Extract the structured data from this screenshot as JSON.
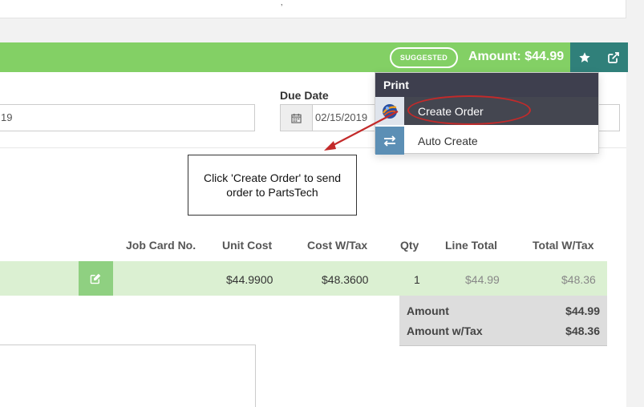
{
  "header": {
    "suggested_badge": "SUGGESTED",
    "amount": "Amount: $44.99"
  },
  "form": {
    "left_date_value": "19",
    "due_date_label": "Due Date",
    "due_date_value": "02/15/2019"
  },
  "print_menu": {
    "title": "Print",
    "items": [
      {
        "label": "Create Order",
        "icon": "partstech-logo-icon"
      },
      {
        "label": "Auto Create",
        "icon": "swap-arrows-icon"
      }
    ]
  },
  "callout": {
    "text": "Click 'Create Order' to send order to PartsTech"
  },
  "table": {
    "headers": [
      "Job Card No.",
      "Unit Cost",
      "Cost W/Tax",
      "Qty",
      "Line Total",
      "Total W/Tax"
    ],
    "row": {
      "job_card_no": "",
      "unit_cost": "$44.9900",
      "cost_w_tax": "$48.3600",
      "qty": "1",
      "line_total": "$44.99",
      "total_w_tax": "$48.36"
    }
  },
  "totals": [
    {
      "label": "Amount",
      "value": "$44.99"
    },
    {
      "label": "Amount w/Tax",
      "value": "$48.36"
    }
  ],
  "colors": {
    "header_green": "#83d065",
    "teal": "#30807a",
    "row_green": "#dbf0d2",
    "annotation_red": "#c32a2a"
  }
}
